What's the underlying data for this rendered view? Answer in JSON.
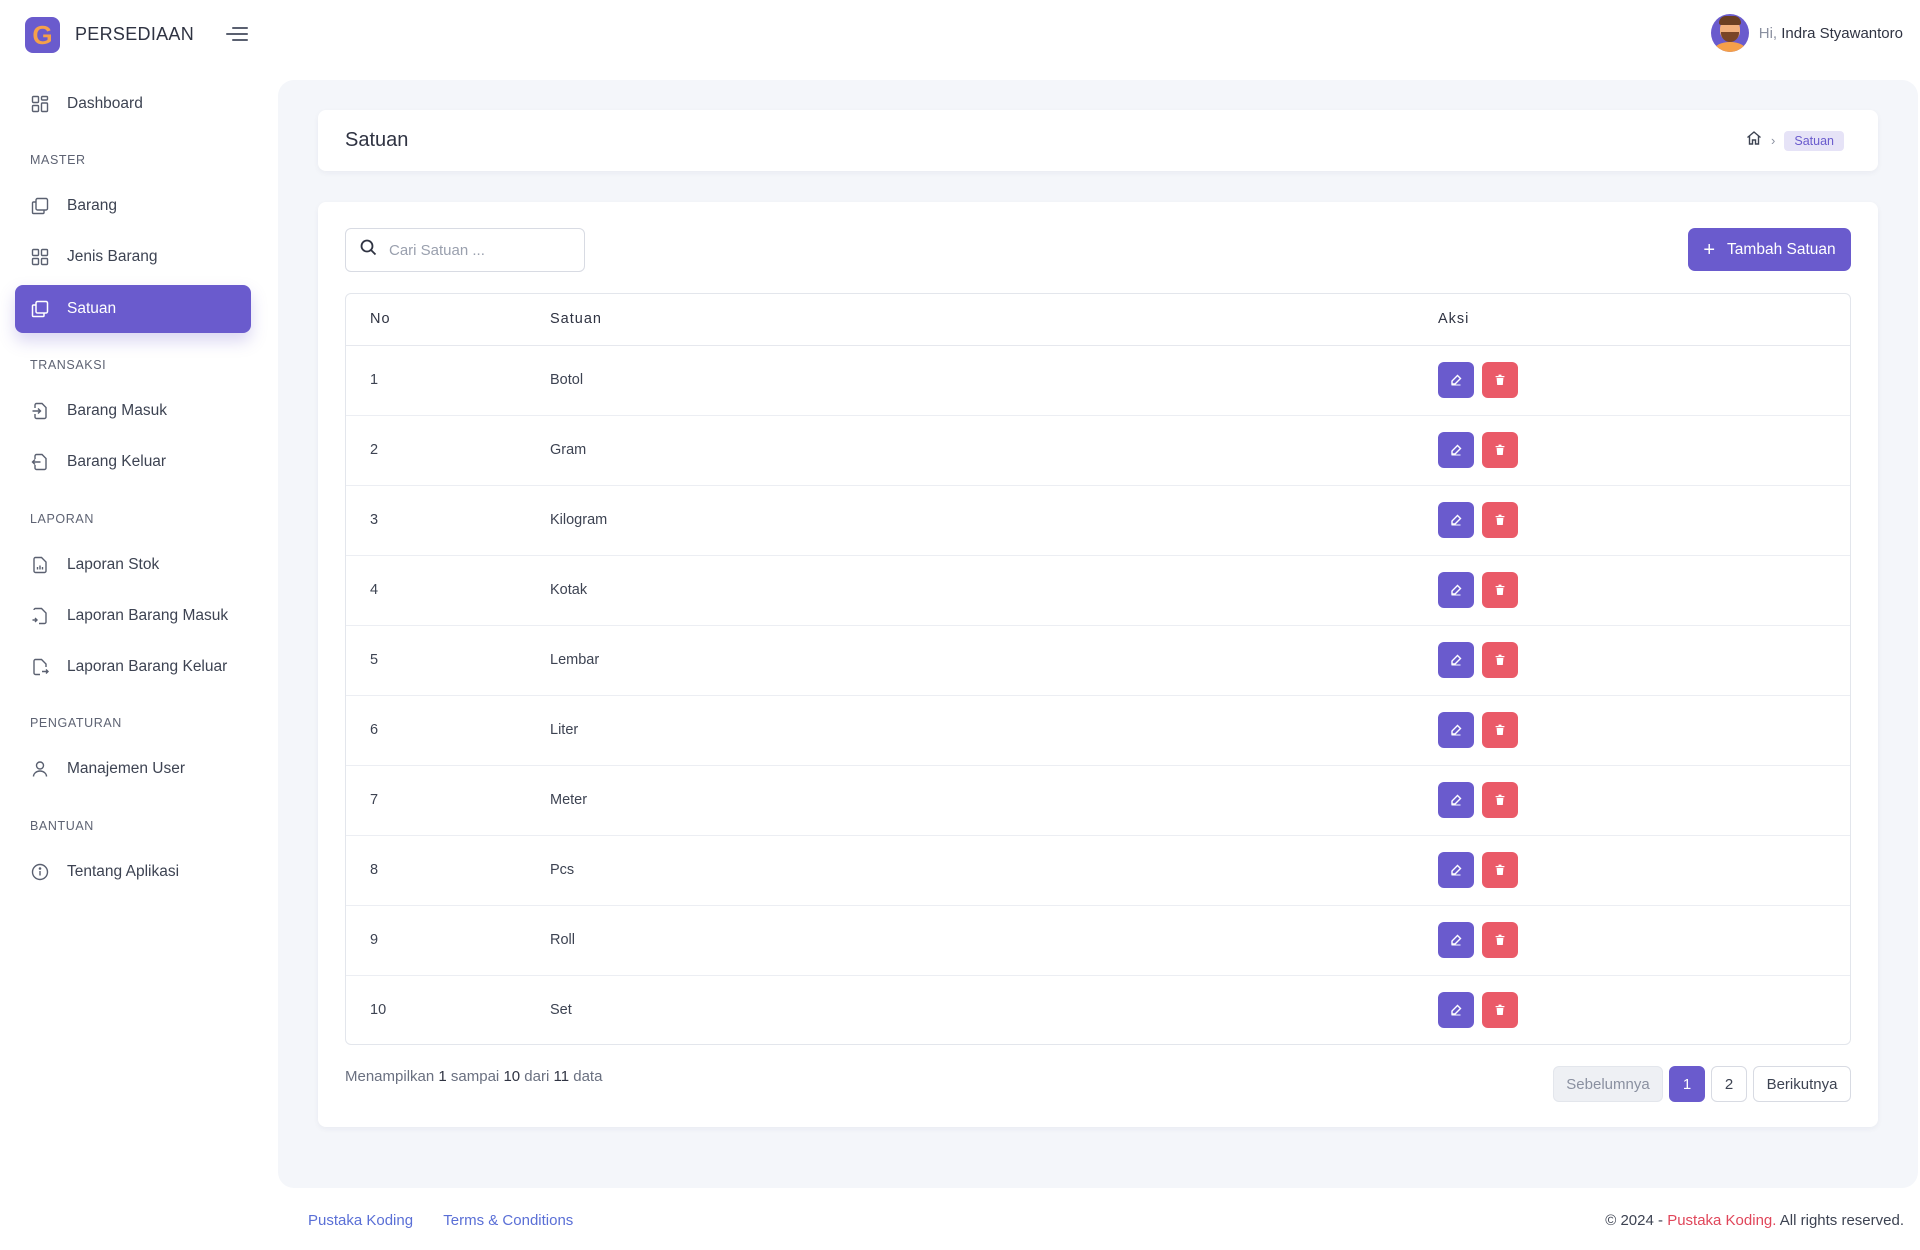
{
  "app": {
    "name": "PERSEDIAAN",
    "logo_letter": "G"
  },
  "user": {
    "greeting": "Hi,",
    "name": "Indra Styawantoro"
  },
  "sidebar": {
    "dashboard": "Dashboard",
    "sections": {
      "master": "MASTER",
      "transaksi": "TRANSAKSI",
      "laporan": "LAPORAN",
      "pengaturan": "PENGATURAN",
      "bantuan": "BANTUAN"
    },
    "items": {
      "barang": "Barang",
      "jenis_barang": "Jenis Barang",
      "satuan": "Satuan",
      "barang_masuk": "Barang Masuk",
      "barang_keluar": "Barang Keluar",
      "laporan_stok": "Laporan Stok",
      "laporan_barang_masuk": "Laporan Barang Masuk",
      "laporan_barang_keluar": "Laporan Barang Keluar",
      "manajemen_user": "Manajemen User",
      "tentang_aplikasi": "Tentang Aplikasi"
    },
    "active": "satuan"
  },
  "page": {
    "title": "Satuan",
    "breadcrumb_current": "Satuan"
  },
  "toolbar": {
    "search_placeholder": "Cari Satuan ...",
    "search_value": "",
    "add_label": "Tambah Satuan"
  },
  "table": {
    "headers": {
      "no": "No",
      "satuan": "Satuan",
      "aksi": "Aksi"
    },
    "rows": [
      {
        "no": "1",
        "satuan": "Botol"
      },
      {
        "no": "2",
        "satuan": "Gram"
      },
      {
        "no": "3",
        "satuan": "Kilogram"
      },
      {
        "no": "4",
        "satuan": "Kotak"
      },
      {
        "no": "5",
        "satuan": "Lembar"
      },
      {
        "no": "6",
        "satuan": "Liter"
      },
      {
        "no": "7",
        "satuan": "Meter"
      },
      {
        "no": "8",
        "satuan": "Pcs"
      },
      {
        "no": "9",
        "satuan": "Roll"
      },
      {
        "no": "10",
        "satuan": "Set"
      }
    ]
  },
  "info": {
    "prefix": "Menampilkan",
    "from": "1",
    "mid1": "sampai",
    "to": "10",
    "mid2": "dari",
    "total": "11",
    "suffix": "data"
  },
  "pagination": {
    "prev": "Sebelumnya",
    "pages": [
      "1",
      "2"
    ],
    "current": "1",
    "next": "Berikutnya"
  },
  "footer": {
    "link1": "Pustaka Koding",
    "link2": "Terms & Conditions",
    "copy_prefix": "© 2024 -",
    "copy_brand": "Pustaka Koding.",
    "copy_suffix": "All rights reserved."
  },
  "colors": {
    "primary": "#6a5bcd",
    "danger": "#ea5a68",
    "accent_orange": "#f5a04a",
    "background": "#f4f6fa"
  },
  "icons": {
    "dashboard": "grid-icon",
    "barang": "copy-icon",
    "jenis_barang": "grid-icon",
    "satuan": "copy-icon",
    "barang_masuk": "file-import-icon",
    "barang_keluar": "file-export-icon",
    "laporan_stok": "file-chart-icon",
    "laporan_barang_masuk": "file-in-icon",
    "laporan_barang_keluar": "file-out-icon",
    "manajemen_user": "user-icon",
    "tentang_aplikasi": "info-icon",
    "edit": "edit-icon",
    "delete": "trash-icon",
    "search": "search-icon",
    "home": "home-icon",
    "menu": "menu-toggle-icon"
  }
}
